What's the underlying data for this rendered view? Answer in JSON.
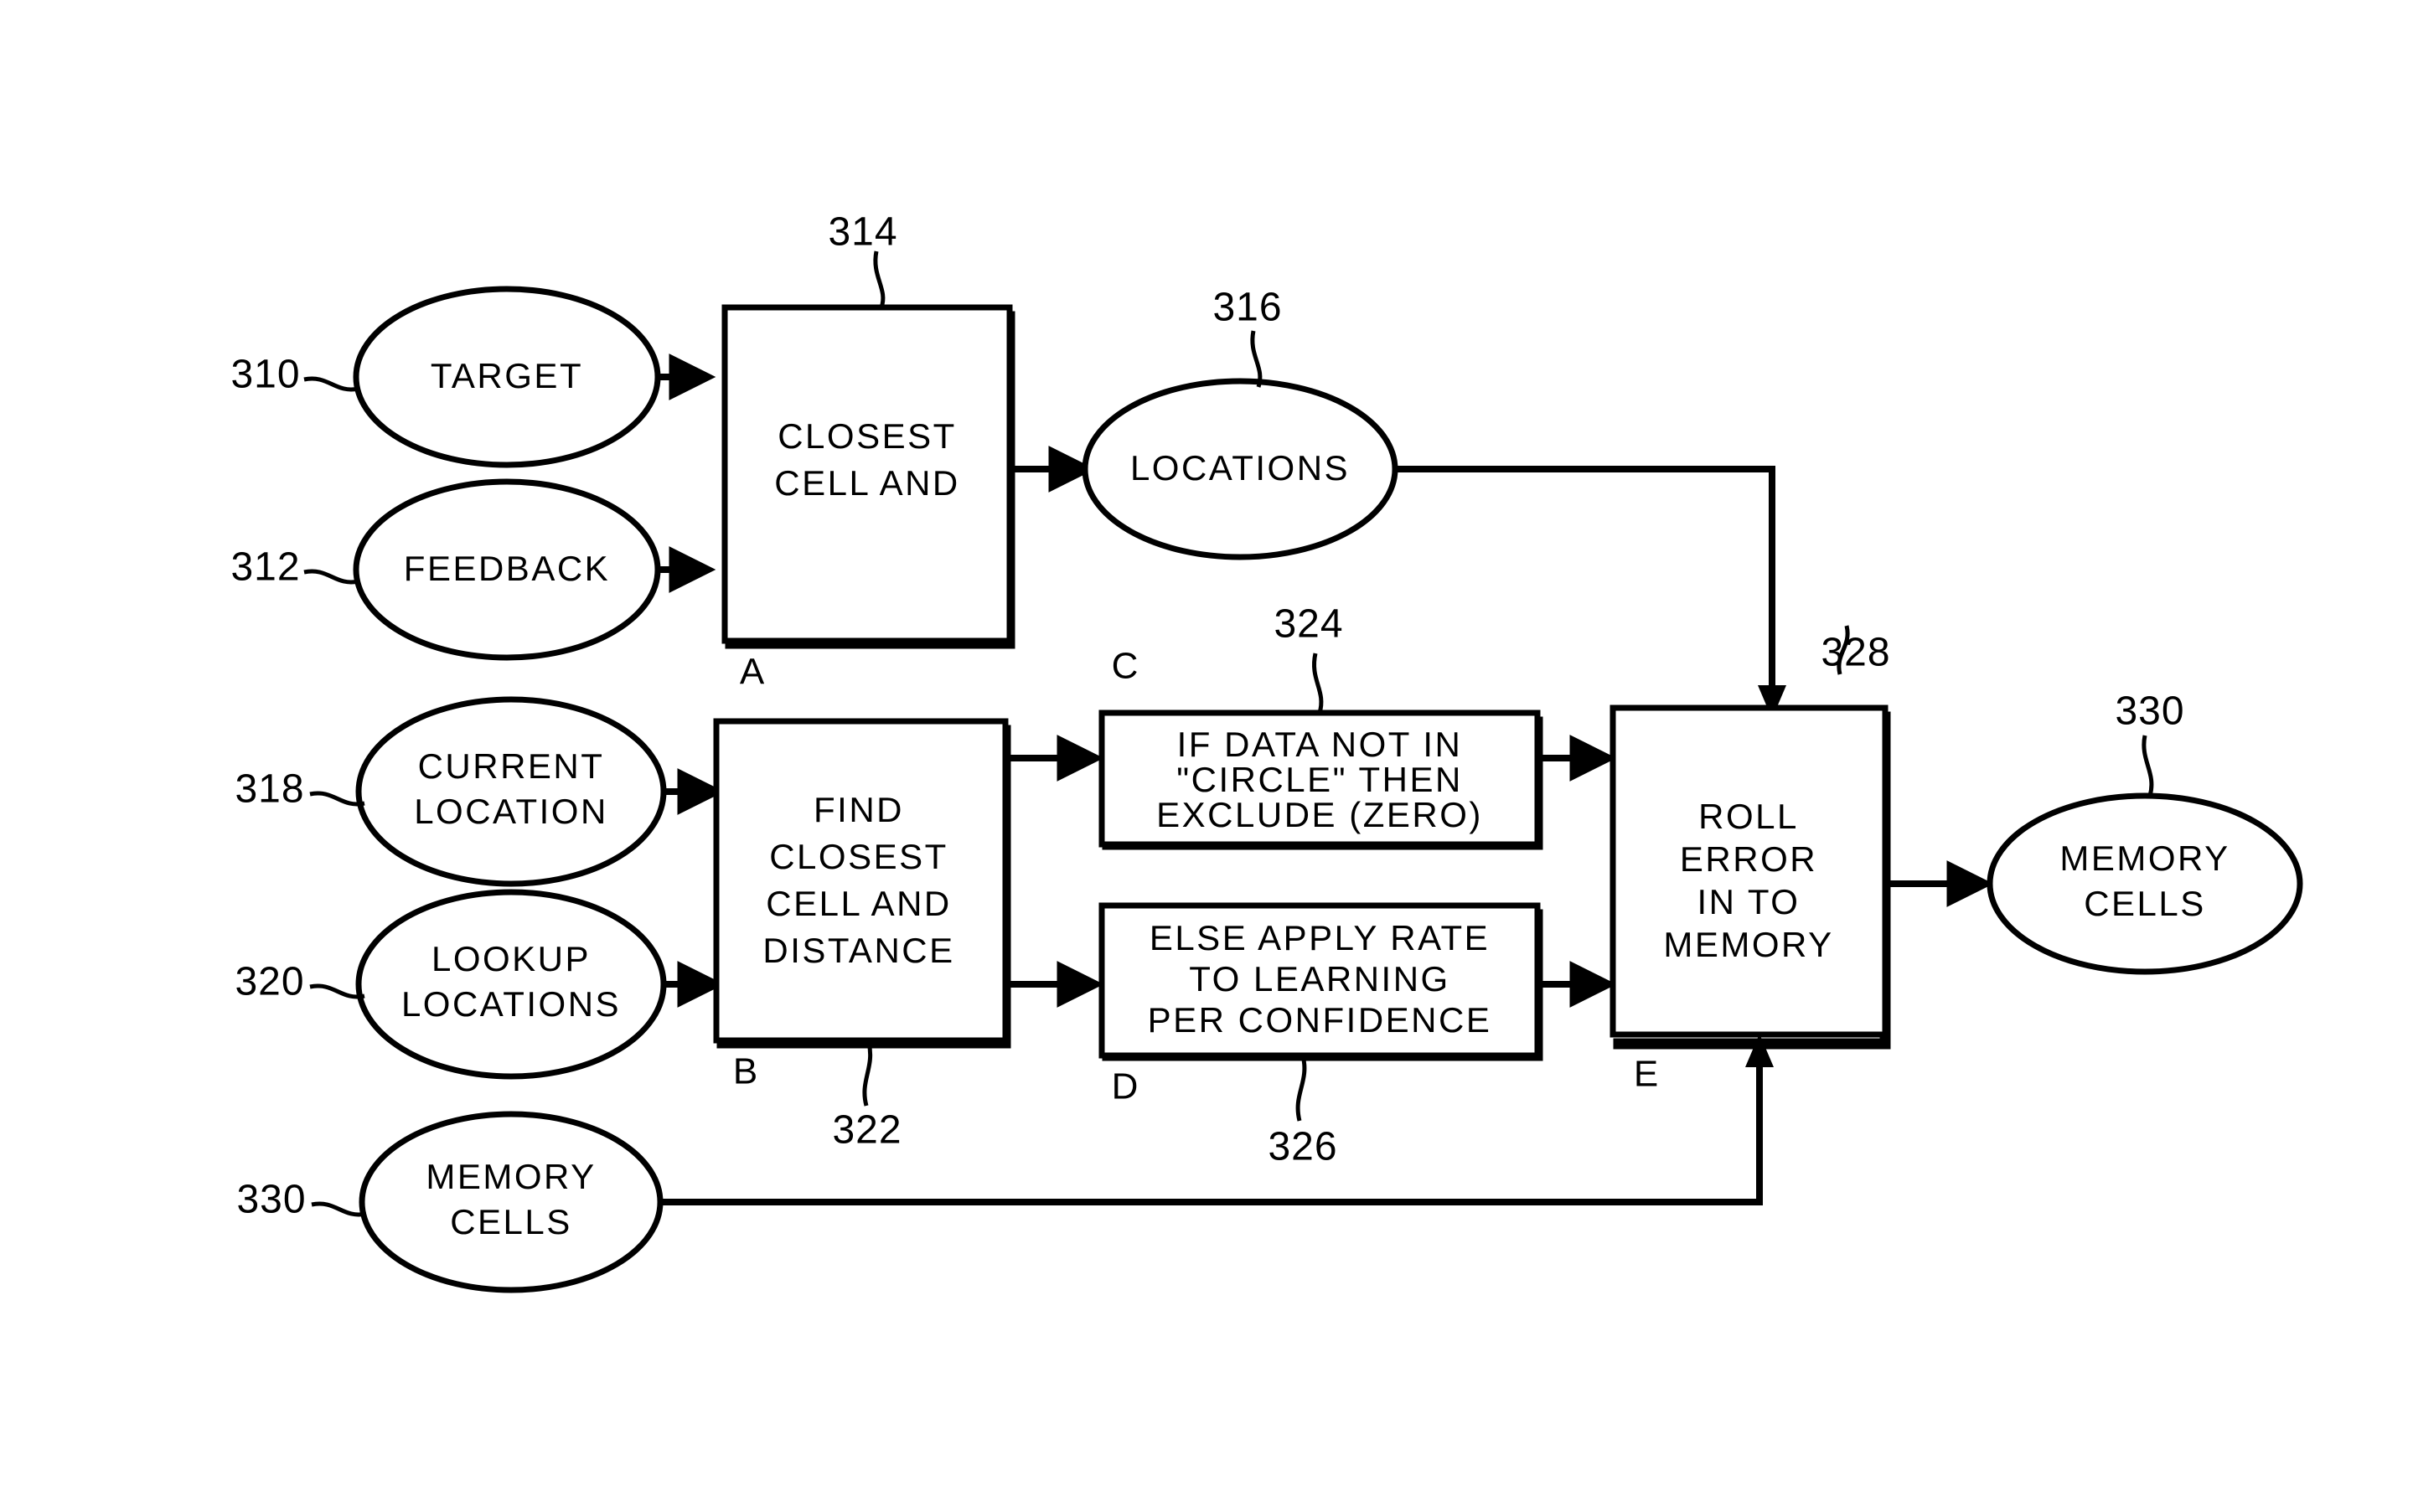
{
  "figure": {
    "type": "patent-flow-diagram",
    "background_color": "#ffffff",
    "line_color": "#000000"
  },
  "nodes": {
    "target": {
      "ref": "310",
      "line1": "TARGET"
    },
    "feedback": {
      "ref": "312",
      "line1": "FEEDBACK"
    },
    "locations": {
      "ref": "316",
      "line1": "LOCATIONS"
    },
    "current_location": {
      "ref": "318",
      "line1": "CURRENT",
      "line2": "LOCATION"
    },
    "lookup_locations": {
      "ref": "320",
      "line1": "LOOKUP",
      "line2": "LOCATIONS"
    },
    "memory_cells_in": {
      "ref": "330",
      "line1": "MEMORY",
      "line2": "CELLS"
    },
    "memory_cells_out": {
      "ref": "330",
      "line1": "MEMORY",
      "line2": "CELLS"
    }
  },
  "boxes": {
    "a": {
      "ref": "314",
      "letter": "A",
      "line1": "CLOSEST",
      "line2": "CELL AND"
    },
    "b": {
      "ref": "322",
      "letter": "B",
      "line1": "FIND",
      "line2": "CLOSEST",
      "line3": "CELL AND",
      "line4": "DISTANCE"
    },
    "c": {
      "ref": "324",
      "letter": "C",
      "line1": "IF DATA NOT IN",
      "line2": "\"CIRCLE\" THEN",
      "line3": "EXCLUDE (ZERO)"
    },
    "d": {
      "ref": "326",
      "letter": "D",
      "line1": "ELSE APPLY RATE",
      "line2": "TO LEARNING",
      "line3": "PER CONFIDENCE"
    },
    "e": {
      "ref": "328",
      "letter": "E",
      "line1": "ROLL",
      "line2": "ERROR",
      "line3": "IN TO",
      "line4": "MEMORY"
    }
  }
}
